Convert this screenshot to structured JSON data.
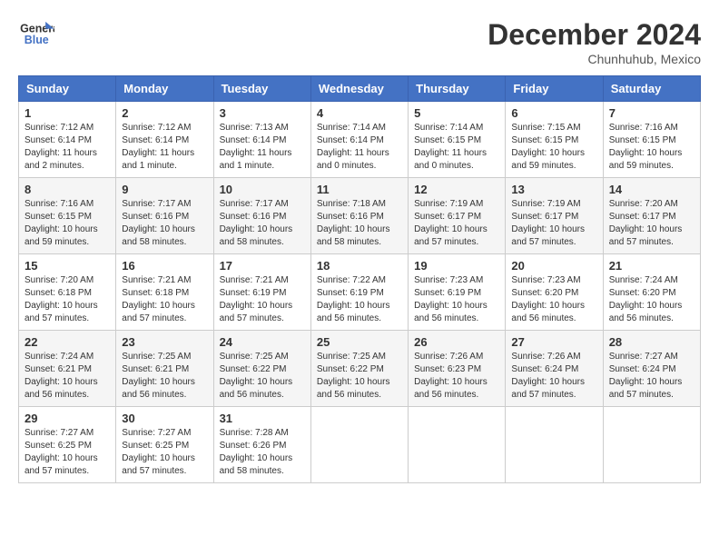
{
  "header": {
    "logo_line1": "General",
    "logo_line2": "Blue",
    "month_title": "December 2024",
    "location": "Chunhuhub, Mexico"
  },
  "weekdays": [
    "Sunday",
    "Monday",
    "Tuesday",
    "Wednesday",
    "Thursday",
    "Friday",
    "Saturday"
  ],
  "weeks": [
    [
      {
        "day": "1",
        "sunrise": "Sunrise: 7:12 AM",
        "sunset": "Sunset: 6:14 PM",
        "daylight": "Daylight: 11 hours and 2 minutes."
      },
      {
        "day": "2",
        "sunrise": "Sunrise: 7:12 AM",
        "sunset": "Sunset: 6:14 PM",
        "daylight": "Daylight: 11 hours and 1 minute."
      },
      {
        "day": "3",
        "sunrise": "Sunrise: 7:13 AM",
        "sunset": "Sunset: 6:14 PM",
        "daylight": "Daylight: 11 hours and 1 minute."
      },
      {
        "day": "4",
        "sunrise": "Sunrise: 7:14 AM",
        "sunset": "Sunset: 6:14 PM",
        "daylight": "Daylight: 11 hours and 0 minutes."
      },
      {
        "day": "5",
        "sunrise": "Sunrise: 7:14 AM",
        "sunset": "Sunset: 6:15 PM",
        "daylight": "Daylight: 11 hours and 0 minutes."
      },
      {
        "day": "6",
        "sunrise": "Sunrise: 7:15 AM",
        "sunset": "Sunset: 6:15 PM",
        "daylight": "Daylight: 10 hours and 59 minutes."
      },
      {
        "day": "7",
        "sunrise": "Sunrise: 7:16 AM",
        "sunset": "Sunset: 6:15 PM",
        "daylight": "Daylight: 10 hours and 59 minutes."
      }
    ],
    [
      {
        "day": "8",
        "sunrise": "Sunrise: 7:16 AM",
        "sunset": "Sunset: 6:15 PM",
        "daylight": "Daylight: 10 hours and 59 minutes."
      },
      {
        "day": "9",
        "sunrise": "Sunrise: 7:17 AM",
        "sunset": "Sunset: 6:16 PM",
        "daylight": "Daylight: 10 hours and 58 minutes."
      },
      {
        "day": "10",
        "sunrise": "Sunrise: 7:17 AM",
        "sunset": "Sunset: 6:16 PM",
        "daylight": "Daylight: 10 hours and 58 minutes."
      },
      {
        "day": "11",
        "sunrise": "Sunrise: 7:18 AM",
        "sunset": "Sunset: 6:16 PM",
        "daylight": "Daylight: 10 hours and 58 minutes."
      },
      {
        "day": "12",
        "sunrise": "Sunrise: 7:19 AM",
        "sunset": "Sunset: 6:17 PM",
        "daylight": "Daylight: 10 hours and 57 minutes."
      },
      {
        "day": "13",
        "sunrise": "Sunrise: 7:19 AM",
        "sunset": "Sunset: 6:17 PM",
        "daylight": "Daylight: 10 hours and 57 minutes."
      },
      {
        "day": "14",
        "sunrise": "Sunrise: 7:20 AM",
        "sunset": "Sunset: 6:17 PM",
        "daylight": "Daylight: 10 hours and 57 minutes."
      }
    ],
    [
      {
        "day": "15",
        "sunrise": "Sunrise: 7:20 AM",
        "sunset": "Sunset: 6:18 PM",
        "daylight": "Daylight: 10 hours and 57 minutes."
      },
      {
        "day": "16",
        "sunrise": "Sunrise: 7:21 AM",
        "sunset": "Sunset: 6:18 PM",
        "daylight": "Daylight: 10 hours and 57 minutes."
      },
      {
        "day": "17",
        "sunrise": "Sunrise: 7:21 AM",
        "sunset": "Sunset: 6:19 PM",
        "daylight": "Daylight: 10 hours and 57 minutes."
      },
      {
        "day": "18",
        "sunrise": "Sunrise: 7:22 AM",
        "sunset": "Sunset: 6:19 PM",
        "daylight": "Daylight: 10 hours and 56 minutes."
      },
      {
        "day": "19",
        "sunrise": "Sunrise: 7:23 AM",
        "sunset": "Sunset: 6:19 PM",
        "daylight": "Daylight: 10 hours and 56 minutes."
      },
      {
        "day": "20",
        "sunrise": "Sunrise: 7:23 AM",
        "sunset": "Sunset: 6:20 PM",
        "daylight": "Daylight: 10 hours and 56 minutes."
      },
      {
        "day": "21",
        "sunrise": "Sunrise: 7:24 AM",
        "sunset": "Sunset: 6:20 PM",
        "daylight": "Daylight: 10 hours and 56 minutes."
      }
    ],
    [
      {
        "day": "22",
        "sunrise": "Sunrise: 7:24 AM",
        "sunset": "Sunset: 6:21 PM",
        "daylight": "Daylight: 10 hours and 56 minutes."
      },
      {
        "day": "23",
        "sunrise": "Sunrise: 7:25 AM",
        "sunset": "Sunset: 6:21 PM",
        "daylight": "Daylight: 10 hours and 56 minutes."
      },
      {
        "day": "24",
        "sunrise": "Sunrise: 7:25 AM",
        "sunset": "Sunset: 6:22 PM",
        "daylight": "Daylight: 10 hours and 56 minutes."
      },
      {
        "day": "25",
        "sunrise": "Sunrise: 7:25 AM",
        "sunset": "Sunset: 6:22 PM",
        "daylight": "Daylight: 10 hours and 56 minutes."
      },
      {
        "day": "26",
        "sunrise": "Sunrise: 7:26 AM",
        "sunset": "Sunset: 6:23 PM",
        "daylight": "Daylight: 10 hours and 56 minutes."
      },
      {
        "day": "27",
        "sunrise": "Sunrise: 7:26 AM",
        "sunset": "Sunset: 6:24 PM",
        "daylight": "Daylight: 10 hours and 57 minutes."
      },
      {
        "day": "28",
        "sunrise": "Sunrise: 7:27 AM",
        "sunset": "Sunset: 6:24 PM",
        "daylight": "Daylight: 10 hours and 57 minutes."
      }
    ],
    [
      {
        "day": "29",
        "sunrise": "Sunrise: 7:27 AM",
        "sunset": "Sunset: 6:25 PM",
        "daylight": "Daylight: 10 hours and 57 minutes."
      },
      {
        "day": "30",
        "sunrise": "Sunrise: 7:27 AM",
        "sunset": "Sunset: 6:25 PM",
        "daylight": "Daylight: 10 hours and 57 minutes."
      },
      {
        "day": "31",
        "sunrise": "Sunrise: 7:28 AM",
        "sunset": "Sunset: 6:26 PM",
        "daylight": "Daylight: 10 hours and 58 minutes."
      },
      null,
      null,
      null,
      null
    ]
  ]
}
